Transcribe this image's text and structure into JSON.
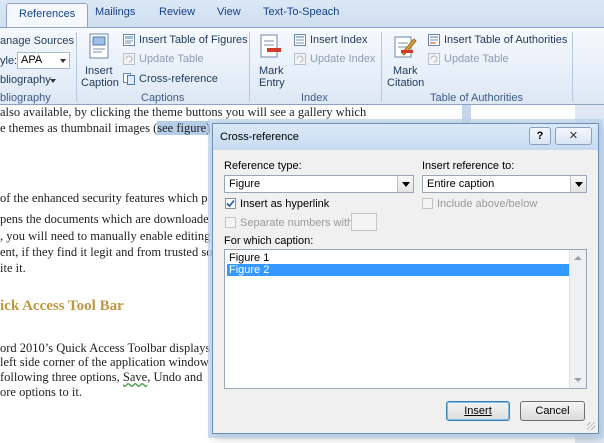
{
  "ribbon": {
    "tabs": [
      "References",
      "Mailings",
      "Review",
      "View",
      "Text-To-Speach"
    ],
    "citations": {
      "manage_sources": "anage Sources",
      "style_label": "yle:",
      "style_value": "APA",
      "bibliography": "bliography",
      "group_label": "bliography"
    },
    "captions": {
      "insert_caption_line1": "Insert",
      "insert_caption_line2": "Caption",
      "insert_table_of_figures": "Insert Table of Figures",
      "update_table": "Update Table",
      "cross_reference": "Cross-reference",
      "group_label": "Captions"
    },
    "index": {
      "mark_entry_line1": "Mark",
      "mark_entry_line2": "Entry",
      "insert_index": "Insert Index",
      "update_index": "Update Index",
      "group_label": "Index"
    },
    "authorities": {
      "mark_citation_line1": "Mark",
      "mark_citation_line2": "Citation",
      "insert_table_of_authorities": "Insert Table of Authorities",
      "update_table": "Update Table",
      "group_label": "Table of Authorities"
    }
  },
  "document": {
    "lines_top": [
      "also available, by clicking the theme buttons you will see a gallery which",
      "e themes as thumbnail images ("
    ],
    "highlight": "see figure)",
    "lines_mid": [
      " of the enhanced security features which p",
      "pens the documents which are downloade",
      ", you will need to manually enable editing",
      "ent, if they find it legit and from trusted so",
      "ite it."
    ],
    "heading": "ick Access Tool Bar",
    "lines_bottom": [
      "ord 2010’s Quick Access Toolbar displays",
      "left side corner of the application window",
      "following three options,",
      "Save",
      ", Undo and",
      "ore options to it."
    ]
  },
  "dialog": {
    "title": "Cross-reference",
    "help_glyph": "?",
    "close_glyph": "✕",
    "reference_type_label": "Reference type:",
    "reference_type_value": "Figure",
    "insert_reference_label": "Insert reference to:",
    "insert_reference_value": "Entire caption",
    "insert_as_hyperlink": "Insert as hyperlink",
    "include_above_below": "Include above/below",
    "separate_numbers": "Separate numbers with",
    "for_which_caption": "For which caption:",
    "captions": [
      "Figure 1",
      "Figure 2"
    ],
    "selected_caption": "Figure 2",
    "insert_button": "Insert",
    "cancel_button": "Cancel"
  },
  "colors": {
    "accent": "#3399ff",
    "heading": "#c0973c",
    "ribbon_text": "#1e395b"
  }
}
